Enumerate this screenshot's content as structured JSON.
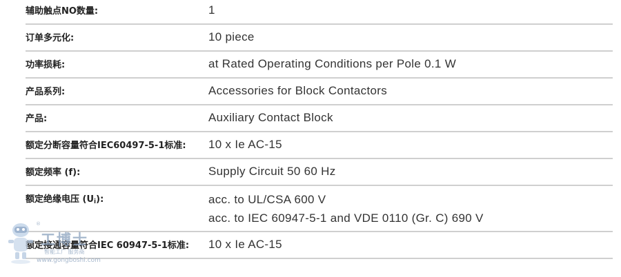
{
  "rows": [
    {
      "label": "辅助触点NO数量:",
      "value": [
        "1"
      ]
    },
    {
      "label": "订单多元化:",
      "value": [
        "10 piece"
      ]
    },
    {
      "label": "功率损耗:",
      "value": [
        "at Rated Operating Conditions per Pole 0.1 W"
      ]
    },
    {
      "label": "产品系列:",
      "value": [
        "Accessories for Block Contactors"
      ]
    },
    {
      "label": "产品:",
      "value": [
        "Auxiliary Contact Block"
      ]
    },
    {
      "label": "额定分断容量符合IEC60497-5-1标准:",
      "value": [
        "10 x Ie AC-15"
      ]
    },
    {
      "label": "额定频率 (f):",
      "value": [
        "Supply Circuit 50 60 Hz"
      ]
    },
    {
      "label_prefix": "额定绝缘电压 (U",
      "label_sub": "i",
      "label_suffix": "):",
      "value": [
        "acc. to UL/CSA 600 V",
        "acc. to IEC 60947-5-1 and VDE 0110 (Gr. C) 690 V"
      ]
    },
    {
      "label": "额定接通容量符合IEC 60947-5-1标准:",
      "value": [
        "10 x Ie AC-15"
      ]
    }
  ],
  "watermark": {
    "brand": "工博士",
    "tagline": "智能工厂 服务商",
    "url": "www.gongboshi.com",
    "registered": "®",
    "mascot_icon": "robot-mascot-icon"
  }
}
